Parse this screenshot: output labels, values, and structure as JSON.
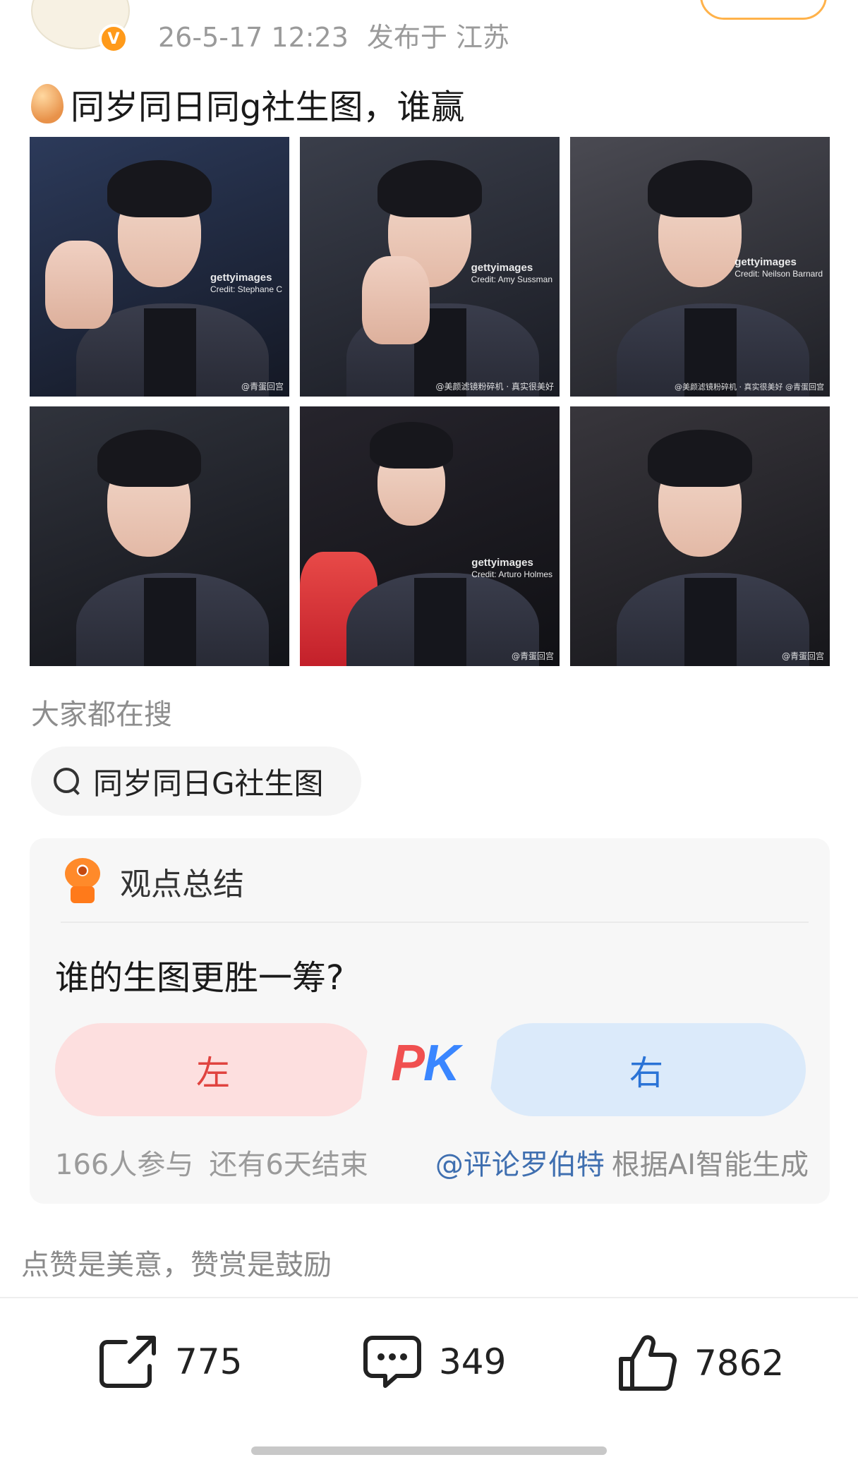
{
  "post": {
    "date": "26-5-17 12:23",
    "location": "发布于 江苏",
    "text": "同岁同日同g社生图，谁赢",
    "photos": [
      {
        "credit_brand": "gettyimages",
        "credit": "Credit: Stephane C",
        "watermark": "@青蛋回宫"
      },
      {
        "credit_brand": "gettyimages",
        "credit": "Credit: Amy Sussman",
        "watermark": "@美颜滤镜粉碎机 · 真实很美好"
      },
      {
        "credit_brand": "gettyimages",
        "credit": "Credit: Neilson Barnard",
        "watermark": "@美颜滤镜粉碎机 · 真实很美好 @青蛋回宫"
      },
      {
        "credit_brand": "",
        "credit": "",
        "watermark": ""
      },
      {
        "credit_brand": "gettyimages",
        "credit": "Credit: Arturo Holmes",
        "watermark": "@青蛋回宫"
      },
      {
        "credit_brand": "",
        "credit": "",
        "watermark": "@青蛋回宫"
      }
    ]
  },
  "hot_search": {
    "label": "大家都在搜",
    "query": "同岁同日G社生图"
  },
  "summary_card": {
    "title": "观点总结",
    "question": "谁的生图更胜一筹?",
    "option_left": "左",
    "pk": {
      "p": "P",
      "k": "K"
    },
    "option_right": "右",
    "participants": "166人参与",
    "remaining": "还有6天结束",
    "ai_mention": "@评论罗伯特",
    "ai_note": "根据AI智能生成"
  },
  "reward_text": "点赞是美意，赞赏是鼓励",
  "actions": {
    "share_count": "775",
    "comment_count": "349",
    "like_count": "7862"
  },
  "icons": [
    "verified-v-icon",
    "egg-icon",
    "search-icon",
    "robot-icon",
    "share-icon",
    "comment-icon",
    "thumbs-up-icon"
  ],
  "colors": {
    "accent_orange": "#ff9a1a",
    "pk_red": "#f05050",
    "pk_blue": "#3a86ff",
    "mention_blue": "#3f6fb0"
  }
}
